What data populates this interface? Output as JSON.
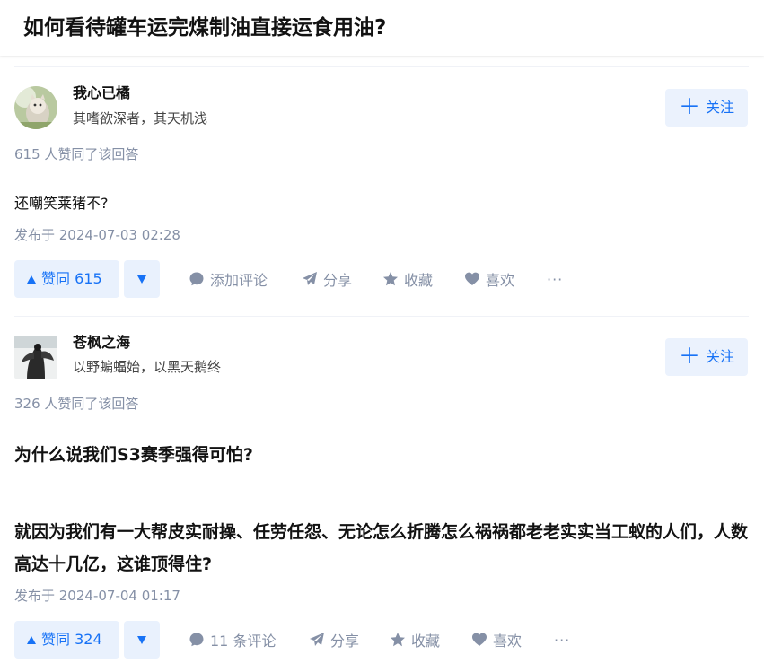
{
  "question": {
    "title": "如何看待罐车运完煤制油直接运食用油?"
  },
  "answers": [
    {
      "author": {
        "name": "我心已橘",
        "bio": "其嗜欲深者，其天机浅"
      },
      "follow_label": "关注",
      "vote_meta": "615 人赞同了该回答",
      "content": [
        "还嘲笑莱猪不?"
      ],
      "publish_time": "发布于 2024-07-03 02:28",
      "actions": {
        "vote_label": "赞同 615",
        "comment_label": "添加评论",
        "share_label": "分享",
        "collect_label": "收藏",
        "like_label": "喜欢",
        "more_label": "···"
      }
    },
    {
      "author": {
        "name": "苍枫之海",
        "bio": "以野蝙蝠始，以黑天鹅终"
      },
      "follow_label": "关注",
      "vote_meta": "326 人赞同了该回答",
      "content": [
        "为什么说我们S3赛季强得可怕?",
        "就因为我们有一大帮皮实耐操、任劳任怨、无论怎么折腾怎么祸祸都老老实实当工蚁的人们，人数高达十几亿，这谁顶得住?"
      ],
      "publish_time": "发布于 2024-07-04 01:17",
      "actions": {
        "vote_label": "赞同 324",
        "comment_label": "11 条评论",
        "share_label": "分享",
        "collect_label": "收藏",
        "like_label": "喜欢",
        "more_label": "···"
      }
    }
  ],
  "colors": {
    "brand_blue": "#1772f6",
    "brand_blue_bg": "#ebf2fd",
    "meta_gray": "#8590a6"
  },
  "icons": {
    "follow": "plus-icon",
    "vote_up": "triangle-up-icon",
    "vote_down": "triangle-down-icon",
    "comment": "comment-bubble-icon",
    "share": "paper-plane-icon",
    "collect": "star-icon",
    "like": "heart-icon"
  }
}
